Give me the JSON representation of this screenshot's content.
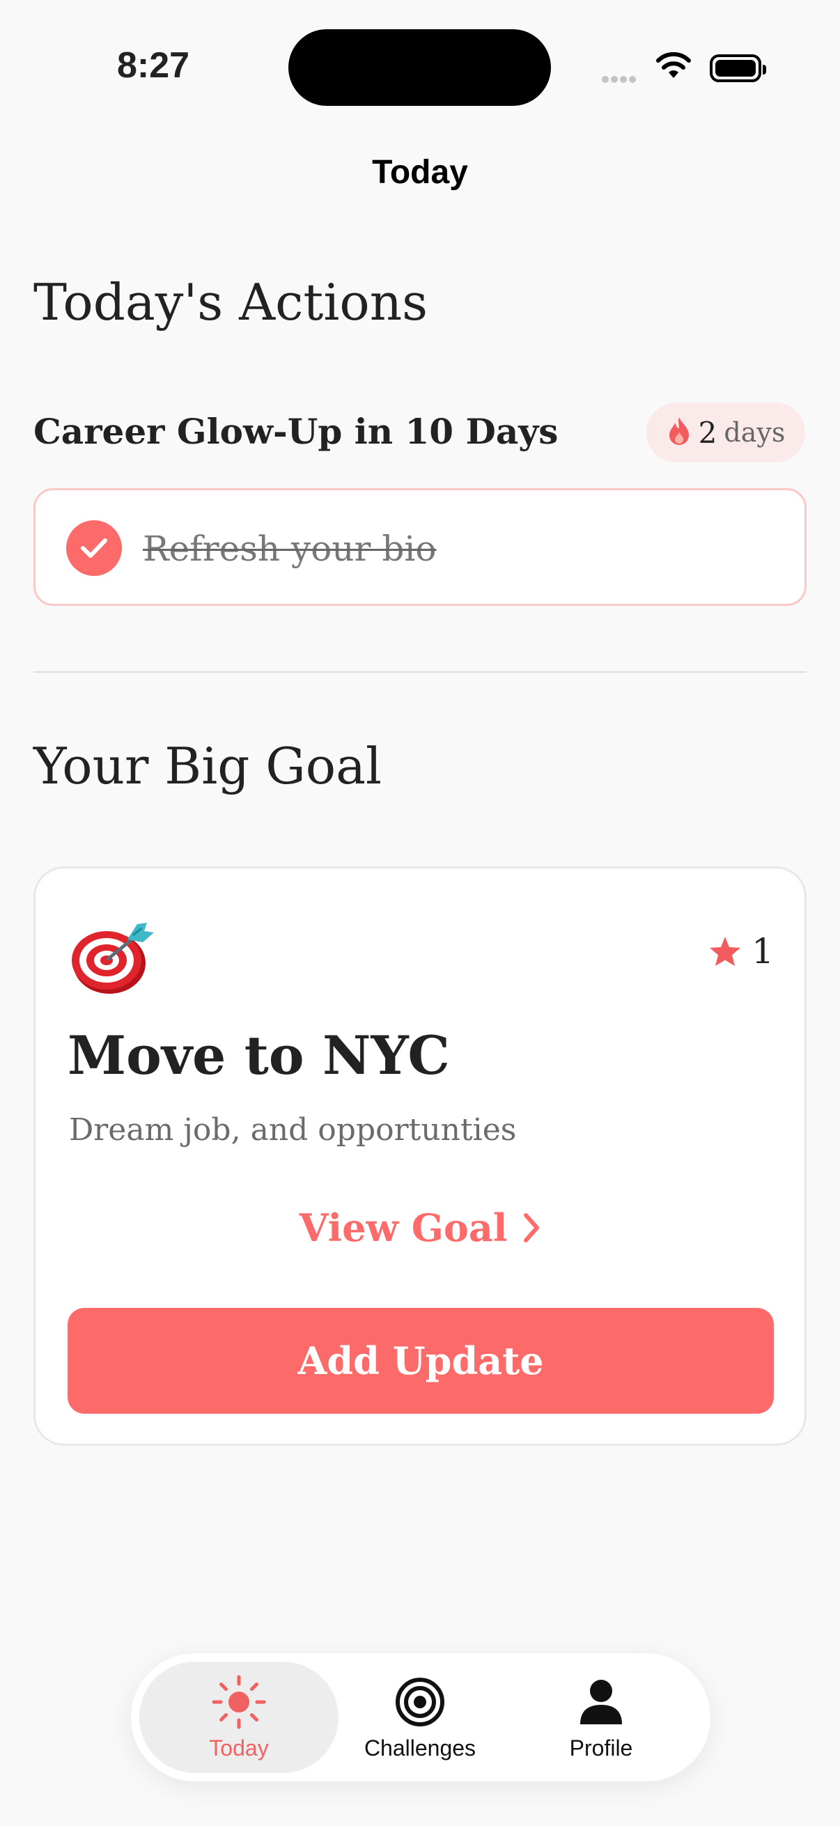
{
  "status_bar": {
    "time": "8:27"
  },
  "nav": {
    "title": "Today"
  },
  "actions": {
    "title": "Today's Actions",
    "challenge": {
      "name": "Career Glow-Up in 10 Days",
      "streak_count": "2",
      "streak_unit": "days",
      "streak_icon": "flame-icon"
    },
    "tasks": [
      {
        "label": "Refresh your bio",
        "completed": true
      }
    ]
  },
  "goal": {
    "section_title": "Your Big Goal",
    "emoji": "dart-target-emoji",
    "stars": "1",
    "title": "Move to NYC",
    "description": "Dream job, and opportunties",
    "view_label": "View Goal",
    "add_update_label": "Add Update"
  },
  "tabbar": {
    "tabs": [
      {
        "label": "Today",
        "icon": "sun-icon",
        "active": true
      },
      {
        "label": "Challenges",
        "icon": "target-icon",
        "active": false
      },
      {
        "label": "Profile",
        "icon": "person-icon",
        "active": false
      }
    ]
  },
  "colors": {
    "accent": "#fd6a6a",
    "background": "#f9f9f9",
    "badge_background": "#fbeaea",
    "task_border": "#f9c9c6"
  }
}
